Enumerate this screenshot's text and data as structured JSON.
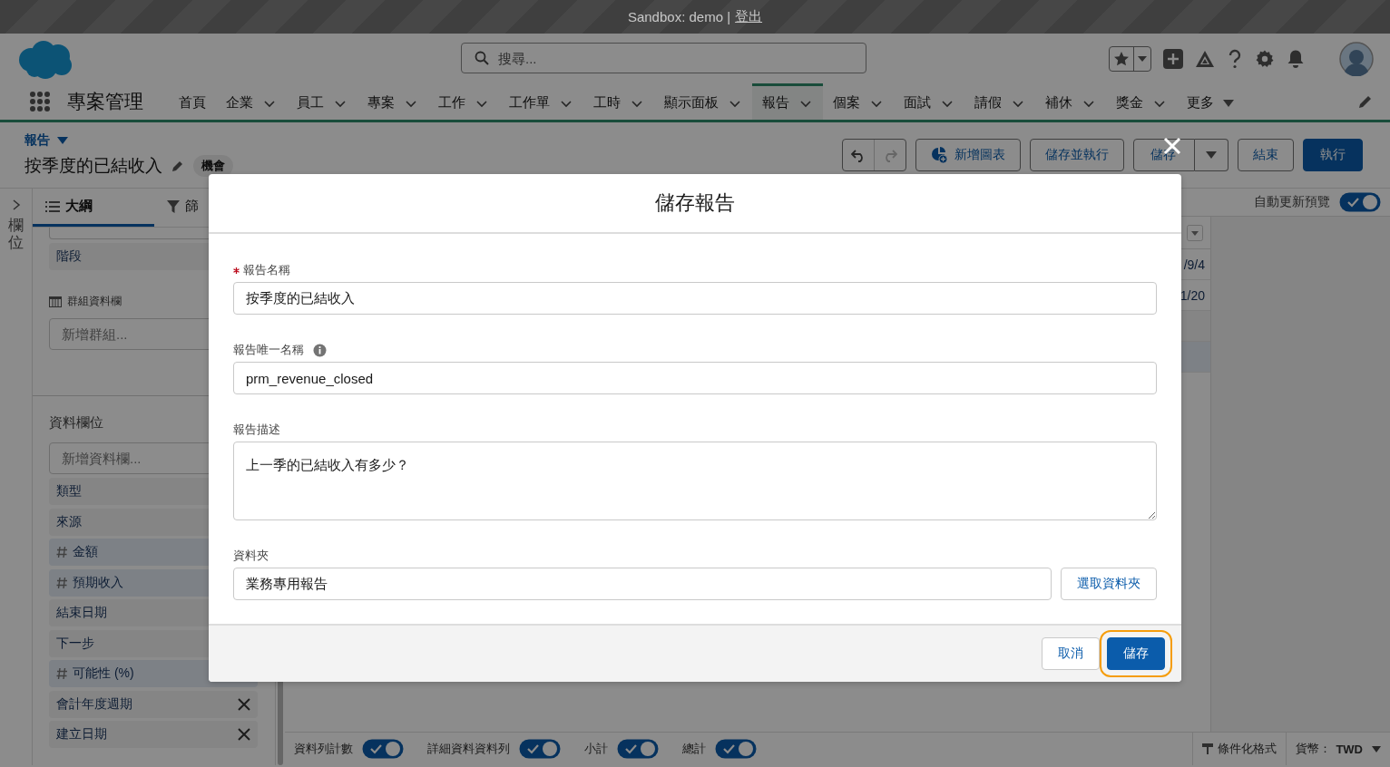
{
  "sandbox_bar": {
    "text": "Sandbox: demo |",
    "logout_link": "登出"
  },
  "header": {
    "search": {
      "placeholder": "搜尋..."
    }
  },
  "nav": {
    "app_name": "專案管理",
    "items": [
      {
        "label": "首頁",
        "kind": "plain",
        "selected": false
      },
      {
        "label": "企業",
        "kind": "menu",
        "selected": false
      },
      {
        "label": "員工",
        "kind": "menu",
        "selected": false
      },
      {
        "label": "專案",
        "kind": "menu",
        "selected": false
      },
      {
        "label": "工作",
        "kind": "menu",
        "selected": false
      },
      {
        "label": "工作單",
        "kind": "menu",
        "selected": false
      },
      {
        "label": "工時",
        "kind": "menu",
        "selected": false
      },
      {
        "label": "顯示面板",
        "kind": "menu",
        "selected": false
      },
      {
        "label": "報告",
        "kind": "menu",
        "selected": true
      },
      {
        "label": "個案",
        "kind": "menu",
        "selected": false
      },
      {
        "label": "面試",
        "kind": "menu",
        "selected": false
      },
      {
        "label": "請假",
        "kind": "menu",
        "selected": false
      },
      {
        "label": "補休",
        "kind": "menu",
        "selected": false
      },
      {
        "label": "獎金",
        "kind": "menu",
        "selected": false
      },
      {
        "label": "更多",
        "kind": "more",
        "selected": false
      }
    ]
  },
  "report_header": {
    "breadcrumb": "報告",
    "title": "按季度的已結收入",
    "badge": "機會",
    "buttons": [
      {
        "label": "新增圖表",
        "kind": "chart"
      },
      {
        "label": "儲存並執行",
        "kind": "neutral"
      },
      {
        "label": "儲存",
        "kind": "split"
      },
      {
        "label": "結束",
        "kind": "neutral"
      },
      {
        "label": "執行",
        "kind": "brand"
      }
    ]
  },
  "fields_strip": {
    "label": "欄位"
  },
  "sidebar": {
    "tabs": [
      {
        "label": "大綱",
        "selected": true
      },
      {
        "label": "篩",
        "selected": false
      }
    ],
    "group_rows": [
      "階段"
    ],
    "group_columns": {
      "label": "群組資料欄",
      "placeholder": "新增群組..."
    },
    "columns": {
      "heading": "資料欄位",
      "placeholder": "新增資料欄...",
      "items": [
        {
          "label": "類型",
          "kind": "text"
        },
        {
          "label": "來源",
          "kind": "text"
        },
        {
          "label": "金額",
          "kind": "number"
        },
        {
          "label": "預期收入",
          "kind": "number"
        },
        {
          "label": "結束日期",
          "kind": "text"
        },
        {
          "label": "下一步",
          "kind": "text"
        },
        {
          "label": "可能性 (%)",
          "kind": "number"
        },
        {
          "label": "會計年度週期",
          "kind": "text",
          "removable": true
        },
        {
          "label": "建立日期",
          "kind": "text",
          "removable": true
        }
      ]
    }
  },
  "preview": {
    "auto_update": {
      "label": "自動更新預覽",
      "on": true
    },
    "rows": [
      "/9/4",
      "1/20"
    ],
    "footer_toggles": [
      {
        "label": "資料列計數",
        "on": true
      },
      {
        "label": "詳細資料資料列",
        "on": true
      },
      {
        "label": "小計",
        "on": true
      },
      {
        "label": "總計",
        "on": true
      }
    ],
    "conditional_format": "條件化格式",
    "currency_label": "貨幣：",
    "currency": "TWD"
  },
  "modal": {
    "title": "儲存報告",
    "fields": [
      {
        "kind": "input",
        "label": "報告名稱",
        "required": true,
        "value": "按季度的已結收入"
      },
      {
        "kind": "input",
        "label": "報告唯一名稱",
        "info": true,
        "value": "prm_revenue_closed"
      },
      {
        "kind": "textarea",
        "label": "報告描述",
        "value": "上一季的已結收入有多少？"
      },
      {
        "kind": "folder",
        "label": "資料夾",
        "value": "業務專用報告",
        "button": "選取資料夾"
      }
    ],
    "cancel": "取消",
    "save": "儲存"
  }
}
